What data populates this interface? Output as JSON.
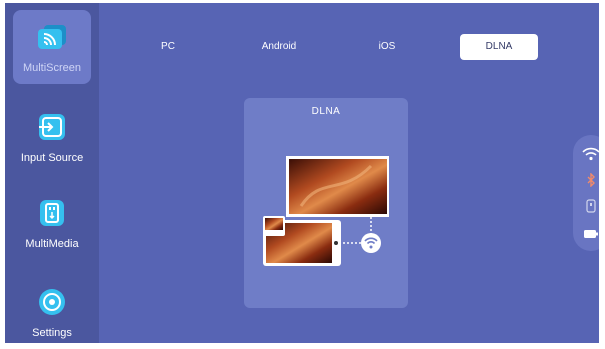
{
  "sidebar": {
    "items": [
      {
        "label": "MultiScreen",
        "icon": "multiscreen-icon",
        "active": true
      },
      {
        "label": "Input Source",
        "icon": "input-source-icon",
        "active": false
      },
      {
        "label": "MultiMedia",
        "icon": "usb-icon",
        "active": false
      },
      {
        "label": "Settings",
        "icon": "settings-icon",
        "active": false
      }
    ]
  },
  "tabs": [
    {
      "label": "PC",
      "active": false
    },
    {
      "label": "Android",
      "active": false
    },
    {
      "label": "iOS",
      "active": false
    },
    {
      "label": "DLNA",
      "active": true
    }
  ],
  "card": {
    "title": "DLNA",
    "illustration": "dlna-casting-illustration"
  },
  "status_icons": [
    "wifi-icon",
    "bluetooth-icon",
    "usb-status-icon",
    "battery-icon"
  ],
  "colors": {
    "background": "#5764b4",
    "sidebar": "#4b579f",
    "active_item": "#6d7ac8",
    "card": "#6f7dc7",
    "icon_cyan": "#2fb8e6"
  }
}
